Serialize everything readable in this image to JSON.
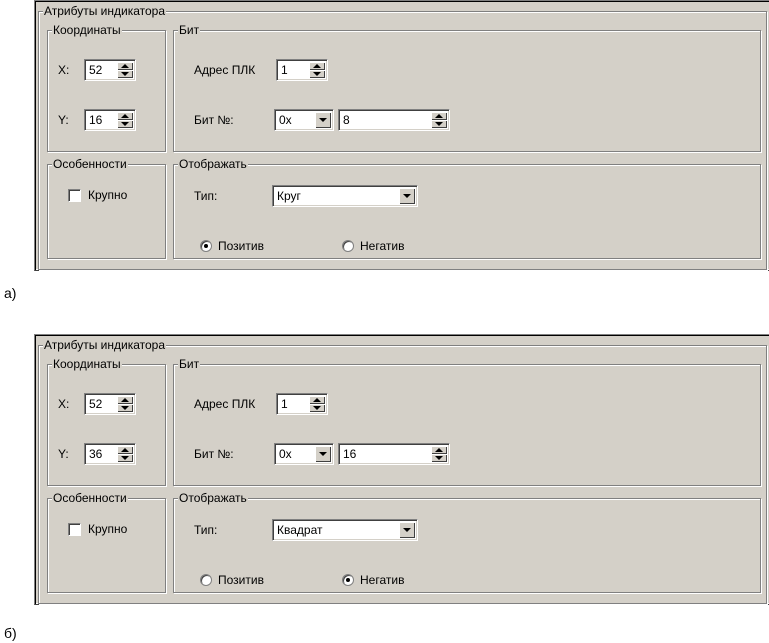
{
  "panels": [
    {
      "tag": "а)",
      "group_title": "Атрибуты индикатора",
      "coords": {
        "title": "Координаты",
        "x_label": "X:",
        "x_value": "52",
        "y_label": "Y:",
        "y_value": "16"
      },
      "bit": {
        "title": "Бит",
        "plc_label": "Адрес ПЛК",
        "plc_value": "1",
        "bitno_label": "Бит №:",
        "base_value": "0x",
        "bit_value": "8"
      },
      "features": {
        "title": "Особенности",
        "large_label": "Крупно",
        "large_checked": false
      },
      "display": {
        "title": "Отображать",
        "type_label": "Тип:",
        "type_value": "Круг",
        "positive_label": "Позитив",
        "negative_label": "Негатив",
        "selected": "positive"
      }
    },
    {
      "tag": "б)",
      "group_title": "Атрибуты индикатора",
      "coords": {
        "title": "Координаты",
        "x_label": "X:",
        "x_value": "52",
        "y_label": "Y:",
        "y_value": "36"
      },
      "bit": {
        "title": "Бит",
        "plc_label": "Адрес ПЛК",
        "plc_value": "1",
        "bitno_label": "Бит №:",
        "base_value": "0x",
        "bit_value": "16"
      },
      "features": {
        "title": "Особенности",
        "large_label": "Крупно",
        "large_checked": false
      },
      "display": {
        "title": "Отображать",
        "type_label": "Тип:",
        "type_value": "Квадрат",
        "positive_label": "Позитив",
        "negative_label": "Негатив",
        "selected": "negative"
      }
    }
  ]
}
